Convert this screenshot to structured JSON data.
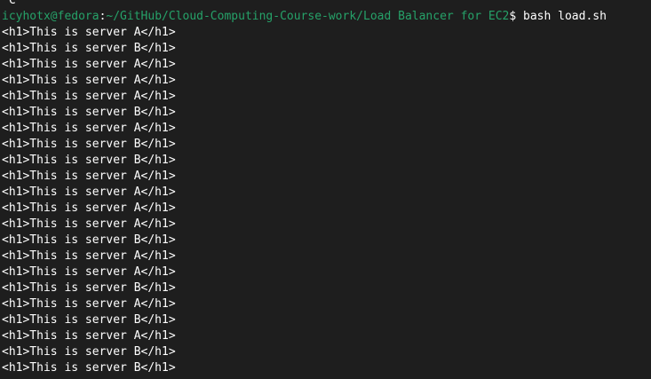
{
  "colors": {
    "background": "#1e1e1e",
    "foreground": "#ffffff",
    "prompt_green": "#26a269"
  },
  "terminal": {
    "interrupt_line": "^C",
    "prompt": {
      "user_host": "icyhotx@fedora",
      "separator": ":",
      "path": "~/GitHub/Cloud-Computing-Course-work/Load Balancer for EC2",
      "sigil": "$",
      "command": " bash load.sh"
    },
    "output_lines": [
      "<h1>This is server A</h1>",
      "<h1>This is server B</h1>",
      "<h1>This is server A</h1>",
      "<h1>This is server A</h1>",
      "<h1>This is server A</h1>",
      "<h1>This is server B</h1>",
      "<h1>This is server A</h1>",
      "<h1>This is server B</h1>",
      "<h1>This is server B</h1>",
      "<h1>This is server A</h1>",
      "<h1>This is server A</h1>",
      "<h1>This is server A</h1>",
      "<h1>This is server A</h1>",
      "<h1>This is server B</h1>",
      "<h1>This is server A</h1>",
      "<h1>This is server A</h1>",
      "<h1>This is server B</h1>",
      "<h1>This is server A</h1>",
      "<h1>This is server B</h1>",
      "<h1>This is server A</h1>",
      "<h1>This is server B</h1>",
      "<h1>This is server B</h1>"
    ]
  }
}
